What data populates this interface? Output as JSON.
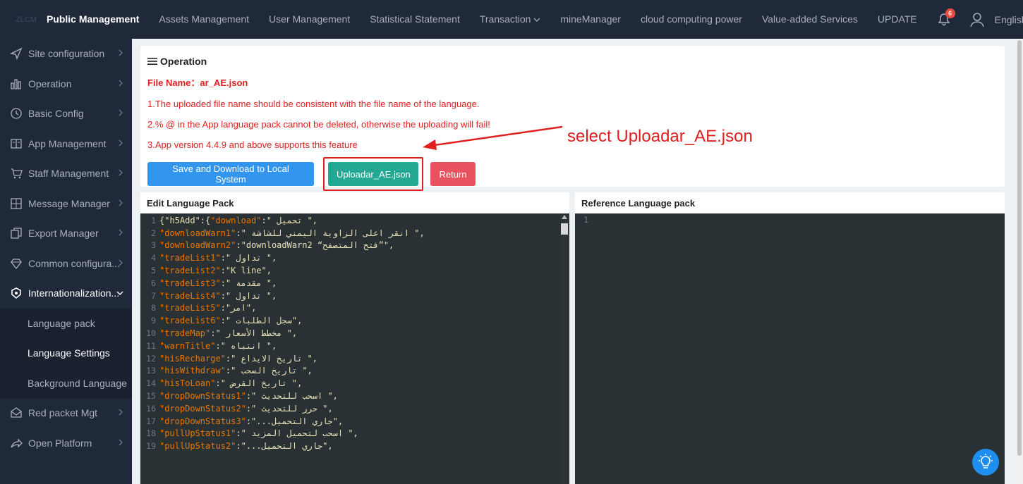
{
  "topbar": {
    "logo_text": "ZLCM",
    "nav": [
      {
        "label": "Public Management",
        "active": true
      },
      {
        "label": "Assets Management"
      },
      {
        "label": "User Management"
      },
      {
        "label": "Statistical Statement"
      },
      {
        "label": "Transaction",
        "dropdown": true
      },
      {
        "label": "mineManager"
      },
      {
        "label": "cloud computing power"
      },
      {
        "label": "Value-added Services"
      },
      {
        "label": "UPDATE"
      }
    ],
    "notification_count": "6",
    "language": "English"
  },
  "sidebar": {
    "items": [
      {
        "label": "Site configuration",
        "icon": "send-icon"
      },
      {
        "label": "Operation",
        "icon": "bar-chart-icon"
      },
      {
        "label": "Basic Config",
        "icon": "clock-icon"
      },
      {
        "label": "App Management",
        "icon": "book-icon"
      },
      {
        "label": "Staff Management",
        "icon": "cart-icon"
      },
      {
        "label": "Message Manager",
        "icon": "grid-icon"
      },
      {
        "label": "Export Manager",
        "icon": "copy-icon"
      },
      {
        "label": "Common configura...",
        "icon": "diamond-icon"
      },
      {
        "label": "Internationalization...",
        "icon": "globe-icon",
        "open": true
      }
    ],
    "subitems": [
      {
        "label": "Language pack"
      },
      {
        "label": "Language Settings",
        "active": true
      },
      {
        "label": "Background Language"
      }
    ],
    "items_after": [
      {
        "label": "Red packet Mgt",
        "icon": "envelope-icon"
      },
      {
        "label": "Open Platform",
        "icon": "share-icon"
      }
    ]
  },
  "operation": {
    "title": "Operation",
    "file_name": "File Name：ar_AE.json",
    "notes": [
      "1.The uploaded file name should be consistent with the file name of the language.",
      "2.% @ in the App language pack cannot be deleted, otherwise the uploading will fail!",
      "3.App version 4.4.9 and above supports this feature"
    ],
    "buttons": {
      "save": "Save and Download to Local System",
      "upload": "Uploadar_AE.json",
      "return": "Return"
    },
    "annotation": "select Uploadar_AE.json"
  },
  "editor_left": {
    "title": "Edit Language Pack",
    "lines": [
      {
        "n": "1",
        "pre": "{\"h5Add\":{",
        "key": "\"download\"",
        "val": ":\" تحميل \","
      },
      {
        "n": "2",
        "key": "\"downloadWarn1\"",
        "val": ":\" انقر اعلى الزاوية اليمني للشاشة \","
      },
      {
        "n": "3",
        "key": "\"downloadWarn2\"",
        "val": ":\"downloadWarn2 “فتح المتصفح”\","
      },
      {
        "n": "4",
        "key": "\"tradeList1\"",
        "val": ":\" تداول \","
      },
      {
        "n": "5",
        "key": "\"tradeList2\"",
        "val": ":\"K line\","
      },
      {
        "n": "6",
        "key": "\"tradeList3\"",
        "val": ":\" مقدمة \","
      },
      {
        "n": "7",
        "key": "\"tradeList4\"",
        "val": ":\" تداول \","
      },
      {
        "n": "8",
        "key": "\"tradeList5\"",
        "val": ":\"امر\","
      },
      {
        "n": "9",
        "key": "\"tradeList6\"",
        "val": ":\" سجل الطلبات\","
      },
      {
        "n": "10",
        "key": "\"tradeMap\"",
        "val": ":\" مخطط الأسعار \","
      },
      {
        "n": "11",
        "key": "\"warnTitle\"",
        "val": ":\" انتباه \","
      },
      {
        "n": "12",
        "key": "\"hisRecharge\"",
        "val": ":\" تاريخ الايداع \","
      },
      {
        "n": "13",
        "key": "\"hisWithdraw\"",
        "val": ":\" تاريخ السحب \","
      },
      {
        "n": "14",
        "key": "\"hisToLoan\"",
        "val": ":\" تاريخ القرض \","
      },
      {
        "n": "15",
        "key": "\"dropDownStatus1\"",
        "val": ":\" اسحب للتحديث \","
      },
      {
        "n": "16",
        "key": "\"dropDownStatus2\"",
        "val": ":\" حرر للتحديث \","
      },
      {
        "n": "17",
        "key": "\"dropDownStatus3\"",
        "val": ":\"...جاري التحميل\","
      },
      {
        "n": "18",
        "key": "\"pullUpStatus1\"",
        "val": ":\" اسحب لتحميل المزيد \","
      },
      {
        "n": "19",
        "key": "\"pullUpStatus2\"",
        "val": ":\"...جاري التحميل\","
      }
    ]
  },
  "editor_right": {
    "title": "Reference Language pack",
    "lines": [
      {
        "n": "1"
      }
    ]
  },
  "colors": {
    "topbar": "#20293a",
    "accent_red": "#e02020",
    "btn_blue": "#3295ee",
    "btn_green": "#23a893",
    "btn_red": "#e9535f",
    "editor_bg": "#293134"
  }
}
